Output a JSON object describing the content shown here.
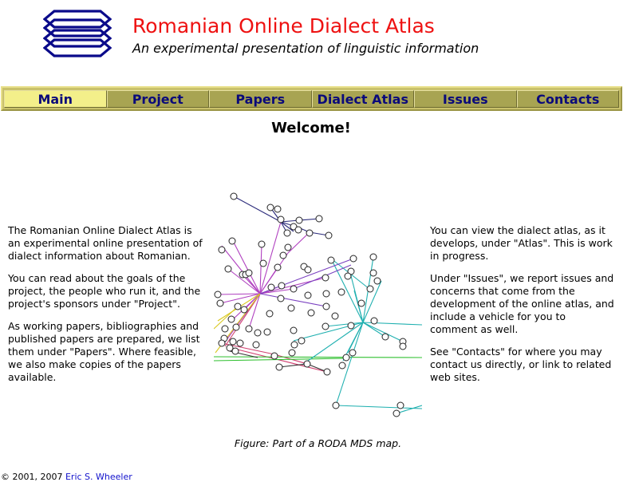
{
  "header": {
    "title": "Romanian Online Dialect Atlas",
    "subtitle": "An experimental presentation of linguistic information",
    "logo_icon": "stacked-hexagons-logo",
    "title_color": "#ee1111"
  },
  "nav": {
    "items": [
      {
        "label": "Main",
        "active": true
      },
      {
        "label": "Project",
        "active": false
      },
      {
        "label": "Papers",
        "active": false
      },
      {
        "label": "Dialect Atlas",
        "active": false
      },
      {
        "label": "Issues",
        "active": false
      },
      {
        "label": "Contacts",
        "active": false
      }
    ],
    "bar_color": "#c9c16b",
    "active_color": "#f3ef8a",
    "label_color": "#0a0a7a"
  },
  "main": {
    "heading": "Welcome!",
    "left_paragraphs": [
      "The Romanian Online Dialect Atlas is an experimental online presentation of dialect information about Romanian.",
      "You can read about the goals of the project, the people who run it, and the project's sponsors under \"Project\".",
      "As working papers, bibliographies and published papers are prepared, we list them under \"Papers\". Where feasible, we also make copies of the papers available."
    ],
    "right_paragraphs": [
      "You can view the dialect atlas, as it develops, under \"Atlas\". This is work in progress.",
      "Under \"Issues\", we report issues and concerns that come from the development of the online atlas, and include a vehicle for you to comment as well.",
      "See \"Contacts\" for where you may contact us directly, or link to related web sites."
    ],
    "figure_caption": "Figure: Part of a RODA MDS map."
  },
  "footer": {
    "copyright": "© 2001, 2007",
    "author_link": "Eric S. Wheeler"
  }
}
